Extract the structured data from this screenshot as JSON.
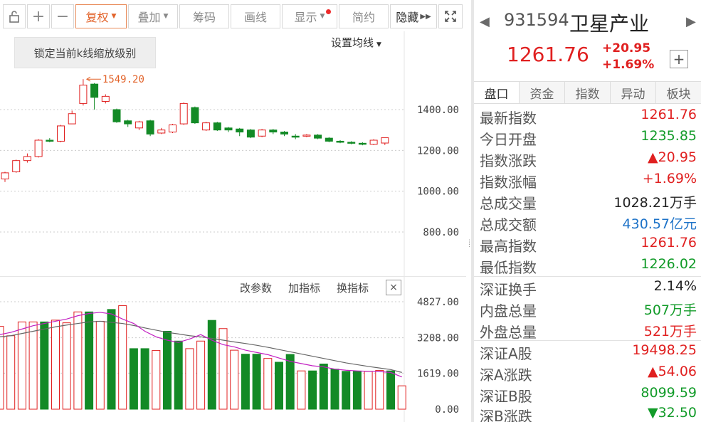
{
  "toolbar": {
    "lock_icon": "lock-open-icon",
    "zoom_in": "+",
    "zoom_out": "−",
    "fuquan": "复权",
    "diejia": "叠加",
    "chouma": "筹码",
    "huaxian": "画线",
    "xianshi": "显示",
    "jianyue": "简约",
    "yincang": "隐藏",
    "fullscreen_icon": "fullscreen-icon",
    "accent": "#e2632a"
  },
  "chart": {
    "lock_tooltip": "锁定当前k线缩放级别",
    "ma_setting": "设置均线",
    "high_marker": "1549.20",
    "price_ticks": [
      "1400.00",
      "1200.00",
      "1000.00",
      "800.00"
    ],
    "volume_ticks": [
      "4827.00",
      "3208.00",
      "1619.00",
      "0.00"
    ],
    "vol_links": [
      "改参数",
      "加指标",
      "换指标"
    ],
    "close_symbol": "×",
    "up_color": "#e02020",
    "down_color": "#138a26"
  },
  "chart_data": {
    "type": "candlestick",
    "price_axis": [
      1400,
      1200,
      1000,
      800
    ],
    "volume_axis": [
      4827,
      3208,
      1619,
      0
    ],
    "candles": [
      {
        "o": 1060,
        "c": 1090,
        "h": 1095,
        "l": 1045
      },
      {
        "o": 1095,
        "c": 1150,
        "h": 1155,
        "l": 1090
      },
      {
        "o": 1150,
        "c": 1170,
        "h": 1185,
        "l": 1140
      },
      {
        "o": 1170,
        "c": 1250,
        "h": 1255,
        "l": 1165
      },
      {
        "o": 1250,
        "c": 1245,
        "h": 1260,
        "l": 1240
      },
      {
        "o": 1245,
        "c": 1320,
        "h": 1325,
        "l": 1240
      },
      {
        "o": 1330,
        "c": 1380,
        "h": 1395,
        "l": 1330
      },
      {
        "o": 1430,
        "c": 1520,
        "h": 1549.2,
        "l": 1420
      },
      {
        "o": 1525,
        "c": 1460,
        "h": 1530,
        "l": 1400
      },
      {
        "o": 1440,
        "c": 1465,
        "h": 1475,
        "l": 1430
      },
      {
        "o": 1400,
        "c": 1340,
        "h": 1405,
        "l": 1335
      },
      {
        "o": 1345,
        "c": 1330,
        "h": 1350,
        "l": 1315
      },
      {
        "o": 1310,
        "c": 1340,
        "h": 1345,
        "l": 1300
      },
      {
        "o": 1345,
        "c": 1280,
        "h": 1350,
        "l": 1270
      },
      {
        "o": 1285,
        "c": 1300,
        "h": 1310,
        "l": 1280
      },
      {
        "o": 1290,
        "c": 1325,
        "h": 1330,
        "l": 1285
      },
      {
        "o": 1330,
        "c": 1430,
        "h": 1435,
        "l": 1325
      },
      {
        "o": 1410,
        "c": 1335,
        "h": 1415,
        "l": 1330
      },
      {
        "o": 1300,
        "c": 1335,
        "h": 1340,
        "l": 1295
      },
      {
        "o": 1335,
        "c": 1300,
        "h": 1340,
        "l": 1295
      },
      {
        "o": 1310,
        "c": 1300,
        "h": 1315,
        "l": 1290
      },
      {
        "o": 1305,
        "c": 1290,
        "h": 1310,
        "l": 1270
      },
      {
        "o": 1300,
        "c": 1265,
        "h": 1305,
        "l": 1260
      },
      {
        "o": 1270,
        "c": 1300,
        "h": 1305,
        "l": 1265
      },
      {
        "o": 1300,
        "c": 1290,
        "h": 1305,
        "l": 1280
      },
      {
        "o": 1290,
        "c": 1280,
        "h": 1295,
        "l": 1270
      },
      {
        "o": 1270,
        "c": 1265,
        "h": 1280,
        "l": 1255
      },
      {
        "o": 1270,
        "c": 1275,
        "h": 1280,
        "l": 1265
      },
      {
        "o": 1275,
        "c": 1260,
        "h": 1280,
        "l": 1255
      },
      {
        "o": 1260,
        "c": 1245,
        "h": 1265,
        "l": 1240
      },
      {
        "o": 1245,
        "c": 1240,
        "h": 1250,
        "l": 1235
      },
      {
        "o": 1240,
        "c": 1235,
        "h": 1245,
        "l": 1230
      },
      {
        "o": 1235,
        "c": 1230,
        "h": 1240,
        "l": 1225
      },
      {
        "o": 1230,
        "c": 1250,
        "h": 1255,
        "l": 1226
      },
      {
        "o": 1236,
        "c": 1262,
        "h": 1262,
        "l": 1226
      }
    ],
    "volumes": [
      3720,
      3300,
      3920,
      3920,
      3920,
      4000,
      3880,
      4370,
      4370,
      3950,
      4480,
      4650,
      2720,
      2720,
      2640,
      3500,
      3060,
      2720,
      3060,
      3990,
      3620,
      2650,
      2470,
      2470,
      2280,
      2110,
      2460,
      1720,
      1720,
      2030,
      1800,
      1700,
      1700,
      1700,
      1740,
      1720,
      1050
    ],
    "volume_up": [
      true,
      true,
      true,
      true,
      false,
      true,
      true,
      true,
      false,
      true,
      false,
      true,
      false,
      false,
      true,
      false,
      false,
      true,
      true,
      false,
      true,
      true,
      false,
      false,
      true,
      false,
      false,
      true,
      false,
      false,
      false,
      false,
      false,
      true,
      true,
      false,
      true
    ],
    "ma_vol_short": [
      3350,
      3450,
      3600,
      3750,
      3850,
      3950,
      4050,
      4200,
      4300,
      4350,
      4280,
      4050,
      3850,
      3500,
      3250,
      3100,
      3000,
      3150,
      3350,
      3100,
      2900,
      2800,
      2650,
      2550,
      2450,
      2300,
      2150,
      2050,
      1950,
      1900,
      1800,
      1750,
      1720,
      1700,
      1690,
      1650,
      1450
    ],
    "ma_vol_long": [
      3250,
      3300,
      3400,
      3500,
      3600,
      3700,
      3780,
      3850,
      3920,
      3950,
      3900,
      3850,
      3760,
      3650,
      3550,
      3450,
      3380,
      3300,
      3250,
      3180,
      3100,
      3020,
      2950,
      2870,
      2780,
      2680,
      2580,
      2480,
      2380,
      2280,
      2180,
      2080,
      2000,
      1920,
      1850,
      1780,
      1650
    ]
  },
  "quote": {
    "code": "931594",
    "name": "卫星产业",
    "price": "1261.76",
    "change": "+20.95",
    "change_pct": "+1.69%",
    "add_symbol": "+",
    "prev_icon": "triangle-left-icon",
    "next_icon": "triangle-right-icon"
  },
  "tabs": [
    "盘口",
    "资金",
    "指数",
    "异动",
    "板块"
  ],
  "info_group1": [
    {
      "label": "最新指数",
      "value": "1261.76",
      "color": "red"
    },
    {
      "label": "今日开盘",
      "value": "1235.85",
      "color": "green"
    },
    {
      "label": "指数涨跌",
      "value": "▲20.95",
      "color": "red"
    },
    {
      "label": "指数涨幅",
      "value": "+1.69%",
      "color": "red"
    },
    {
      "label": "总成交量",
      "value": "1028.21万手",
      "color": "dark"
    },
    {
      "label": "总成交额",
      "value": "430.57亿元",
      "color": "blue"
    },
    {
      "label": "最高指数",
      "value": "1261.76",
      "color": "red"
    },
    {
      "label": "最低指数",
      "value": "1226.02",
      "color": "green"
    }
  ],
  "info_group2": [
    {
      "label": "深证换手",
      "value": "2.14%",
      "color": "dark"
    },
    {
      "label": "内盘总量",
      "value": "507万手",
      "color": "green"
    },
    {
      "label": "外盘总量",
      "value": "521万手",
      "color": "red"
    }
  ],
  "info_group3": [
    {
      "label": "深证A股",
      "value": "19498.25",
      "color": "red"
    },
    {
      "label": "深A涨跌",
      "value": "▲54.06",
      "color": "red"
    },
    {
      "label": "深证B股",
      "value": "8099.59",
      "color": "green"
    },
    {
      "label": "深B涨跌",
      "value": "▼32.50",
      "color": "green"
    }
  ]
}
